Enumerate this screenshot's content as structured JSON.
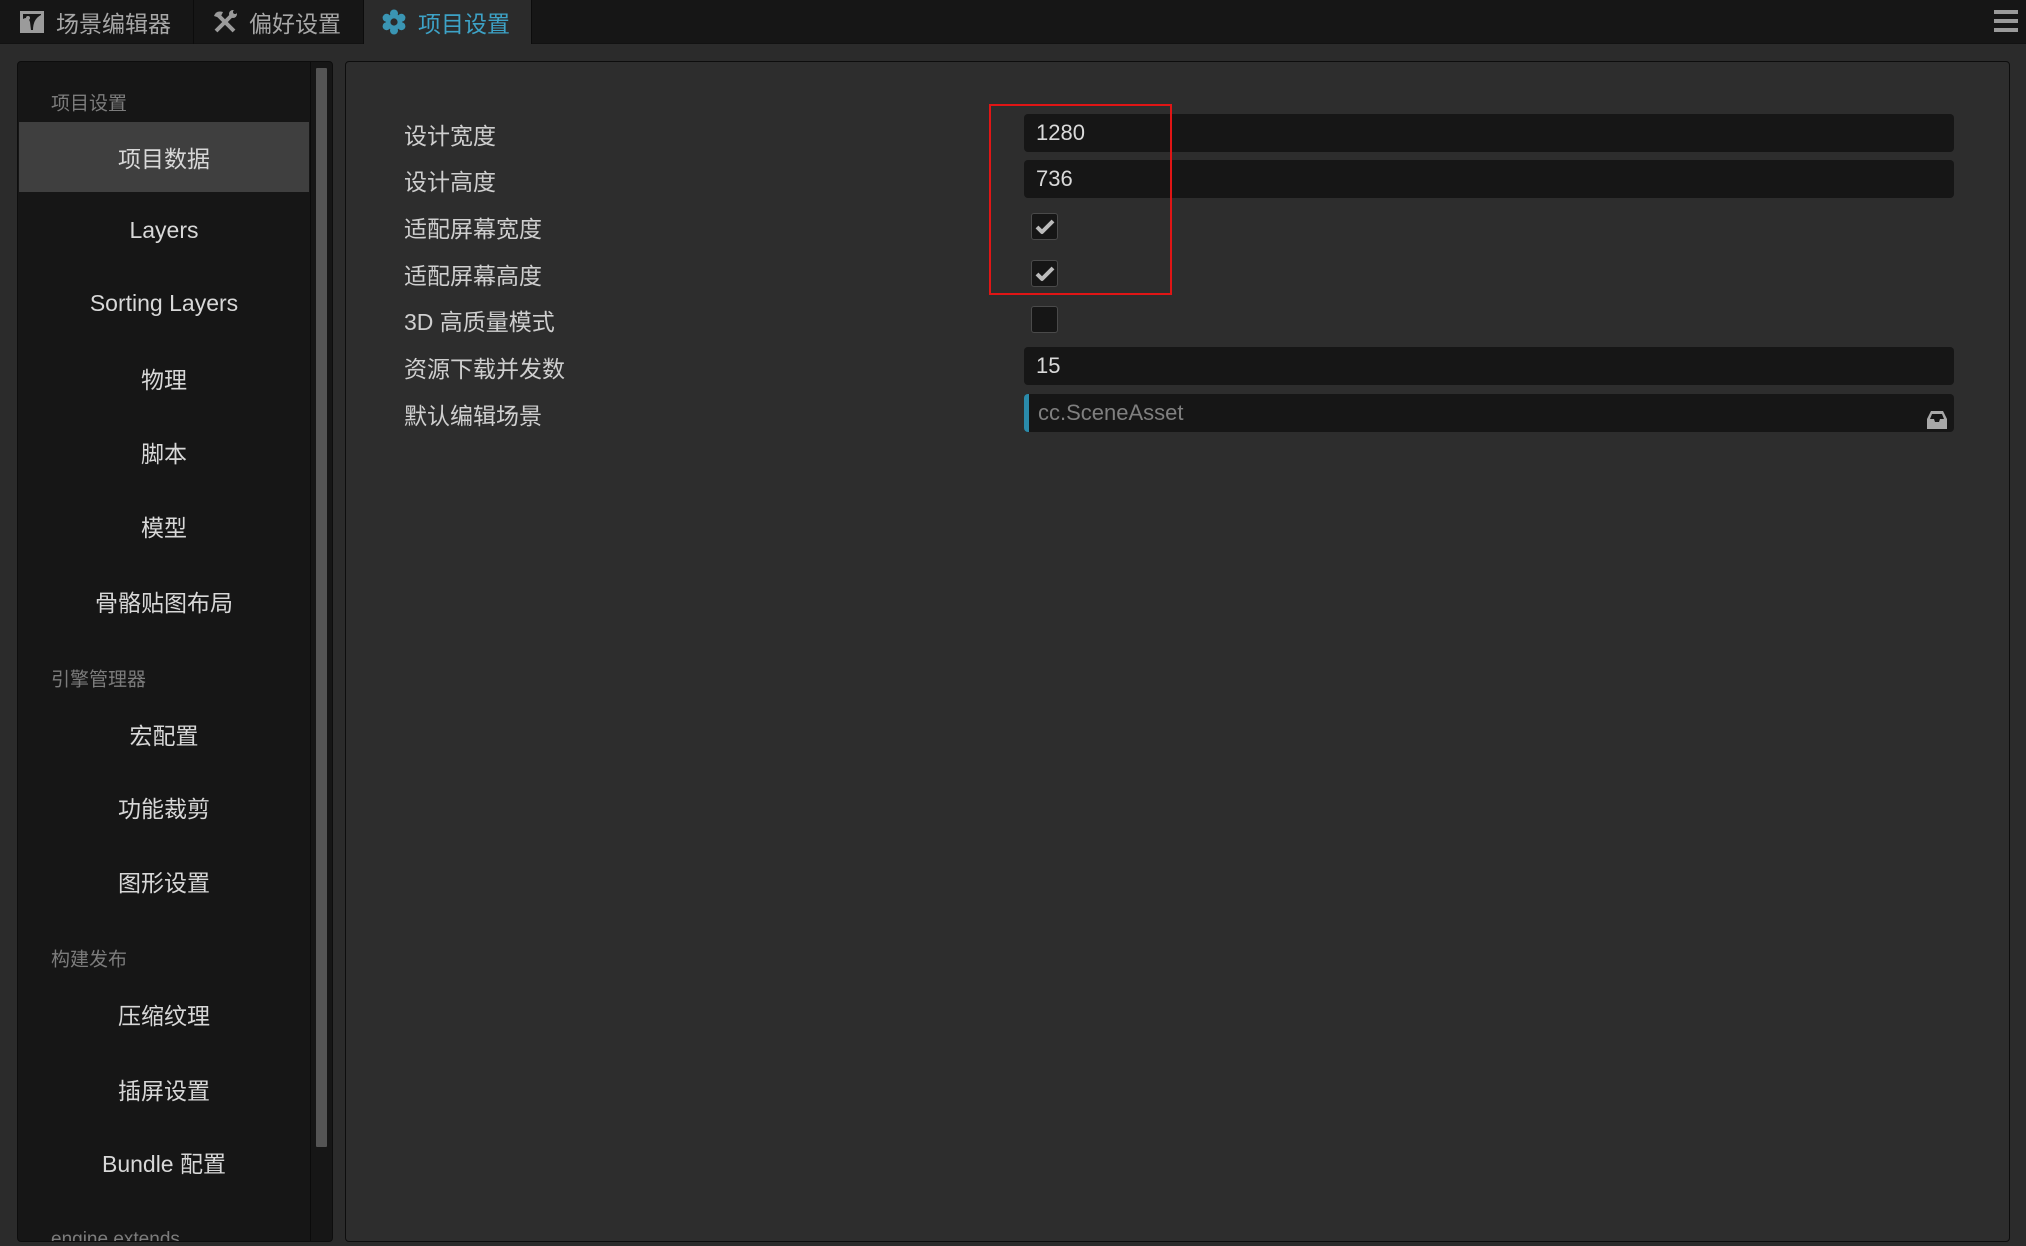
{
  "tabs": [
    {
      "label": "场景编辑器",
      "icon": "image-icon",
      "active": false
    },
    {
      "label": "偏好设置",
      "icon": "tools-icon",
      "active": false
    },
    {
      "label": "项目设置",
      "icon": "gear-icon",
      "active": true
    }
  ],
  "colors": {
    "accent": "#3da2c6",
    "highlight_box": "#e01515"
  },
  "sidebar": {
    "sections": [
      {
        "header": "项目设置",
        "items": [
          {
            "label": "项目数据",
            "active": true
          },
          {
            "label": "Layers"
          },
          {
            "label": "Sorting Layers"
          },
          {
            "label": "物理"
          },
          {
            "label": "脚本"
          },
          {
            "label": "模型"
          },
          {
            "label": "骨骼贴图布局"
          }
        ]
      },
      {
        "header": "引擎管理器",
        "items": [
          {
            "label": "宏配置"
          },
          {
            "label": "功能裁剪"
          },
          {
            "label": "图形设置"
          }
        ]
      },
      {
        "header": "构建发布",
        "items": [
          {
            "label": "压缩纹理"
          },
          {
            "label": "插屏设置"
          },
          {
            "label": "Bundle 配置"
          }
        ]
      },
      {
        "header": "engine extends",
        "items": []
      }
    ]
  },
  "form": {
    "design_width": {
      "label": "设计宽度",
      "value": "1280"
    },
    "design_height": {
      "label": "设计高度",
      "value": "736"
    },
    "fit_width": {
      "label": "适配屏幕宽度",
      "checked": true
    },
    "fit_height": {
      "label": "适配屏幕高度",
      "checked": true
    },
    "hq_3d": {
      "label": "3D 高质量模式",
      "checked": false
    },
    "download_concurrency": {
      "label": "资源下载并发数",
      "value": "15"
    },
    "default_scene": {
      "label": "默认编辑场景",
      "placeholder": "cc.SceneAsset"
    }
  }
}
